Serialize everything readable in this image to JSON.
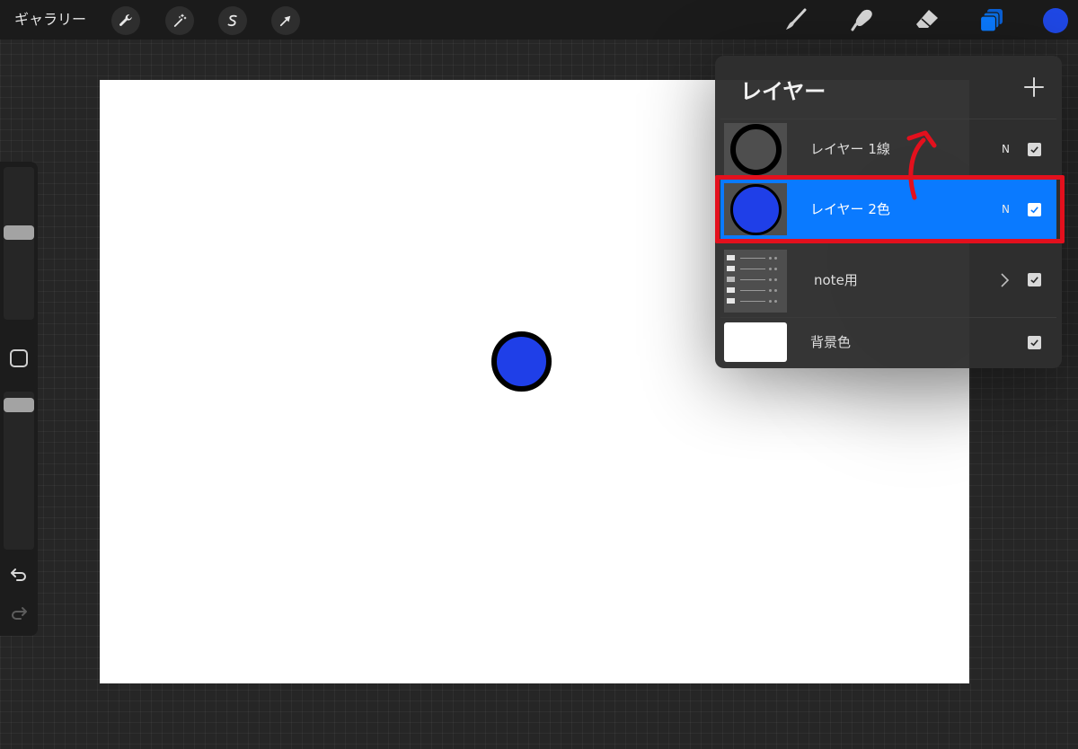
{
  "toolbar": {
    "gallery_label": "ギャラリー",
    "left_tools": [
      "wrench-icon",
      "magic-wand-icon",
      "selection-s-icon",
      "transform-arrow-icon"
    ],
    "right_tools": [
      "brush-icon",
      "smudge-icon",
      "eraser-icon",
      "layers-icon"
    ],
    "active_tool": "layers-icon",
    "current_color": "#1f48e6",
    "accent_color": "#0a7aff"
  },
  "sidebar": {
    "brush_size_slider": "upper",
    "opacity_slider": "lower",
    "modify_button": "square",
    "undo_icon": "undo-icon",
    "redo_icon": "redo-icon"
  },
  "canvas": {
    "background": "#ffffff",
    "shape": "circle",
    "shape_fill": "#1f3fe8",
    "shape_stroke": "#000000"
  },
  "layers_panel": {
    "title": "レイヤー",
    "add_button_icon": "plus-icon",
    "layers": [
      {
        "name": "レイヤー 1線",
        "blend_mode": "N",
        "visible": true,
        "selected": false,
        "thumbnail": "black-ring"
      },
      {
        "name": "レイヤー 2色",
        "blend_mode": "N",
        "visible": true,
        "selected": true,
        "thumbnail": "blue-circle"
      },
      {
        "name": "note用",
        "type": "group",
        "expand_icon": "chevron-right-icon",
        "visible": true,
        "selected": false,
        "thumbnail": "group-preview"
      },
      {
        "name": "背景色",
        "visible": true,
        "selected": false,
        "thumbnail": "white"
      }
    ]
  },
  "annotation": {
    "highlight_color": "#e3101d",
    "arrow": "curved-up-arrow"
  }
}
